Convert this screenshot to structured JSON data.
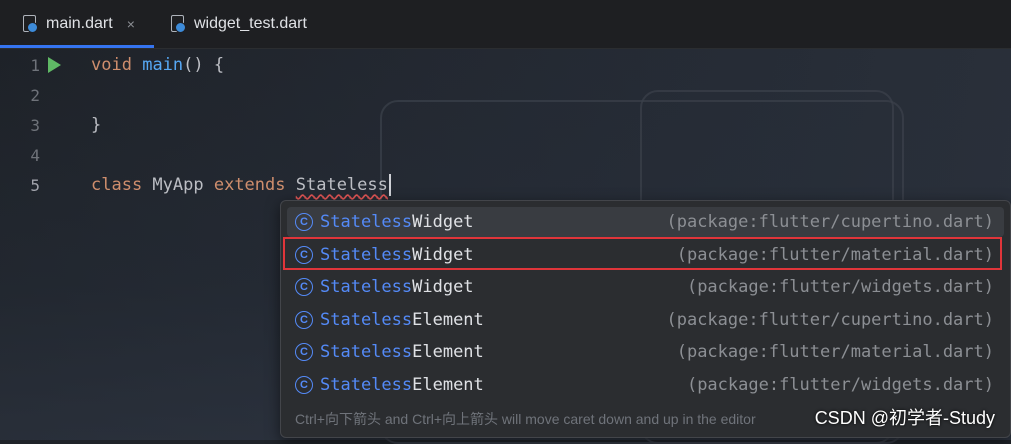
{
  "tabs": [
    {
      "label": "main.dart",
      "active": true,
      "close": "×"
    },
    {
      "label": "widget_test.dart",
      "active": false
    }
  ],
  "editor": {
    "lines": [
      {
        "number": "1",
        "parts": [
          {
            "t": "void",
            "c": "kw"
          },
          {
            "t": " "
          },
          {
            "t": "main",
            "c": "fn"
          },
          {
            "t": "() {"
          }
        ]
      },
      {
        "number": "2",
        "parts": []
      },
      {
        "number": "3",
        "parts": [
          {
            "t": "}"
          }
        ]
      },
      {
        "number": "4",
        "parts": []
      },
      {
        "number": "5",
        "parts": [
          {
            "t": "class",
            "c": "kw"
          },
          {
            "t": " MyApp "
          },
          {
            "t": "extends",
            "c": "kw"
          },
          {
            "t": " "
          },
          {
            "t": "Stateless",
            "c": "typo"
          }
        ]
      }
    ]
  },
  "completion": {
    "items": [
      {
        "match": "Stateless",
        "rest": "Widget",
        "package": "(package:flutter/cupertino.dart)",
        "icon": "C"
      },
      {
        "match": "Stateless",
        "rest": "Widget",
        "package": "(package:flutter/material.dart)",
        "icon": "C"
      },
      {
        "match": "Stateless",
        "rest": "Widget",
        "package": "(package:flutter/widgets.dart)",
        "icon": "C"
      },
      {
        "match": "Stateless",
        "rest": "Element",
        "package": "(package:flutter/cupertino.dart)",
        "icon": "C"
      },
      {
        "match": "Stateless",
        "rest": "Element",
        "package": "(package:flutter/material.dart)",
        "icon": "C"
      },
      {
        "match": "Stateless",
        "rest": "Element",
        "package": "(package:flutter/widgets.dart)",
        "icon": "C"
      }
    ],
    "hint": "Ctrl+向下箭头 and Ctrl+向上箭头 will move caret down and up in the editor",
    "watermark": "CSDN @初学者-Study"
  },
  "colors": {
    "accent": "#3574f0",
    "highlight": "#e0353a",
    "match": "#548af7"
  }
}
